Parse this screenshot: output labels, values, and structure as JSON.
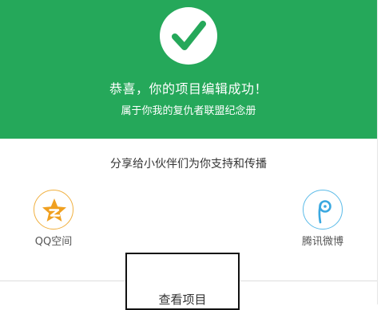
{
  "hero": {
    "background_color": "#25a85a",
    "icon": "checkmark-icon",
    "title": "恭喜，你的项目编辑成功！",
    "subtitle": "属于你我的复仇者联盟纪念册"
  },
  "share": {
    "title": "分享给小伙伴们为你支持和传播",
    "items": [
      {
        "icon": "qzone-icon",
        "label": "QQ空间",
        "color": "#f0a020"
      },
      {
        "icon": "tencent-weibo-icon",
        "label": "腾讯微博",
        "color": "#3aa8e0"
      }
    ]
  },
  "actions": {
    "view_project_label": "查看项目"
  }
}
